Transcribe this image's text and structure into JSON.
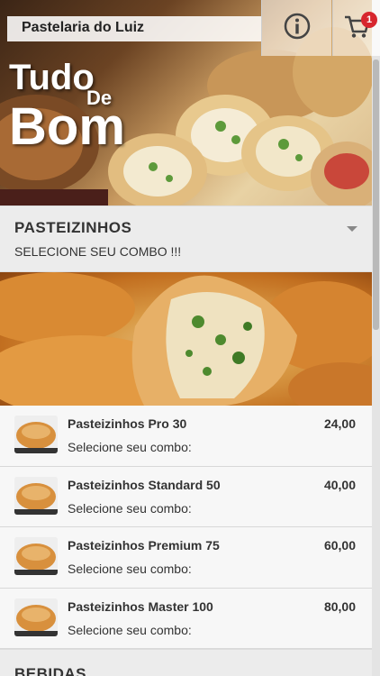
{
  "header": {
    "title": "Pastelaria do Luiz",
    "cart_count": "1"
  },
  "hero": {
    "line1": "Tudo",
    "line2": "De",
    "line3": "Bom"
  },
  "categories": [
    {
      "title": "PASTEIZINHOS",
      "subtitle": "SELECIONE SEU COMBO !!!",
      "items": [
        {
          "name": "Pasteizinhos Pro 30",
          "subtitle": "Selecione seu combo:",
          "price": "24,00"
        },
        {
          "name": "Pasteizinhos Standard 50",
          "subtitle": "Selecione seu combo:",
          "price": "40,00"
        },
        {
          "name": "Pasteizinhos Premium 75",
          "subtitle": "Selecione seu combo:",
          "price": "60,00"
        },
        {
          "name": "Pasteizinhos Master 100",
          "subtitle": "Selecione seu combo:",
          "price": "80,00"
        }
      ]
    },
    {
      "title": "BEBIDAS"
    }
  ],
  "colors": {
    "badge": "#d7262e",
    "background": "#f1f1f1"
  },
  "icons": [
    "info-icon",
    "cart-icon",
    "chevron-down-icon"
  ]
}
